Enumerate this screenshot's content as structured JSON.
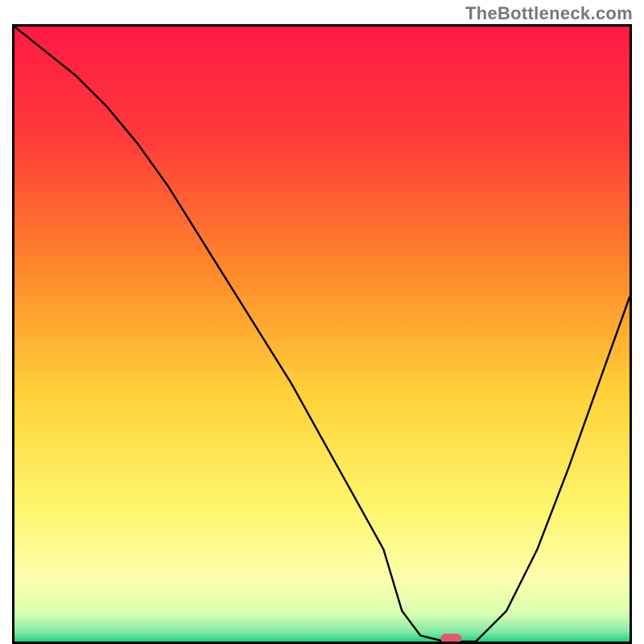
{
  "watermark": "TheBottleneck.com",
  "chart_data": {
    "type": "line",
    "title": "",
    "xlabel": "",
    "ylabel": "",
    "xlim": [
      0,
      100
    ],
    "ylim": [
      0,
      100
    ],
    "x": [
      0,
      5,
      10,
      15,
      20,
      25,
      30,
      35,
      40,
      45,
      50,
      55,
      60,
      63,
      66,
      70,
      75,
      80,
      85,
      90,
      95,
      100
    ],
    "values": [
      100,
      96,
      92,
      87,
      81,
      74,
      66,
      58,
      50,
      42,
      33,
      24,
      15,
      5,
      1,
      0,
      0,
      5,
      15,
      28,
      42,
      56
    ],
    "marker": {
      "x": 71,
      "y": 0.5
    },
    "gradient_stops": [
      {
        "pos": 0.0,
        "color": "#ff1a44"
      },
      {
        "pos": 0.18,
        "color": "#ff3a3a"
      },
      {
        "pos": 0.4,
        "color": "#ff8a2a"
      },
      {
        "pos": 0.6,
        "color": "#ffd23a"
      },
      {
        "pos": 0.78,
        "color": "#fff56b"
      },
      {
        "pos": 0.9,
        "color": "#fdffb0"
      },
      {
        "pos": 0.955,
        "color": "#d8ffb0"
      },
      {
        "pos": 0.985,
        "color": "#7fe9a8"
      },
      {
        "pos": 1.0,
        "color": "#1fd07a"
      }
    ]
  }
}
